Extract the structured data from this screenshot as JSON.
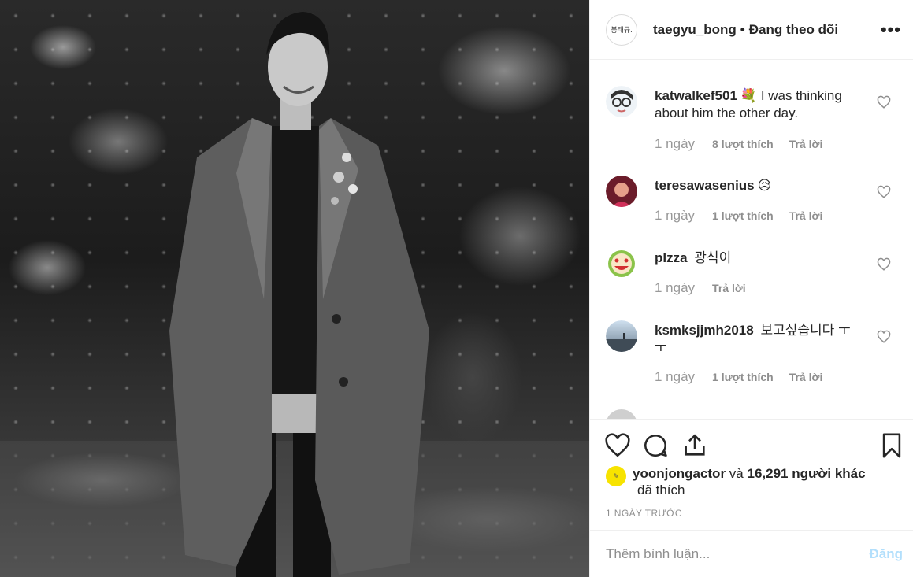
{
  "header": {
    "avatar_text": "봉태규.",
    "username": "taegyu_bong",
    "separator": "•",
    "follow_status": "Đang theo dõi",
    "more_icon": "more-horizontal-icon",
    "more_label": "•••"
  },
  "comments": [
    {
      "username": "katwalkef501",
      "emoji": "💐",
      "text": "I was thinking about him the other day.",
      "time": "1 ngày",
      "likes": "8 lượt thích",
      "reply": "Trả lời"
    },
    {
      "username": "teresawasenius",
      "emoji": "😥",
      "text": "",
      "time": "1 ngày",
      "likes": "1 lượt thích",
      "reply": "Trả lời"
    },
    {
      "username": "plzza",
      "emoji": "",
      "text": "광식이",
      "time": "1 ngày",
      "likes": "",
      "reply": "Trả lời"
    },
    {
      "username": "ksmksjjmh2018",
      "emoji": "",
      "text": "보고싶습니다 ㅜㅜ",
      "time": "1 ngày",
      "likes": "1 lượt thích",
      "reply": "Trả lời"
    }
  ],
  "actions": {
    "like_icon": "heart-icon",
    "comment_icon": "comment-icon",
    "share_icon": "share-icon",
    "save_icon": "bookmark-icon"
  },
  "likes_summary": {
    "user": "yoonjongactor",
    "conjunction": "và",
    "others": "16,291 người khác",
    "suffix": "đã thích"
  },
  "timestamp": "1 NGÀY TRƯỚC",
  "add_comment": {
    "placeholder": "Thêm bình luận...",
    "post_label": "Đăng"
  },
  "colors": {
    "post_button_disabled": "#b2dffc",
    "meta_text": "#8e8e8e",
    "primary_text": "#262626"
  }
}
